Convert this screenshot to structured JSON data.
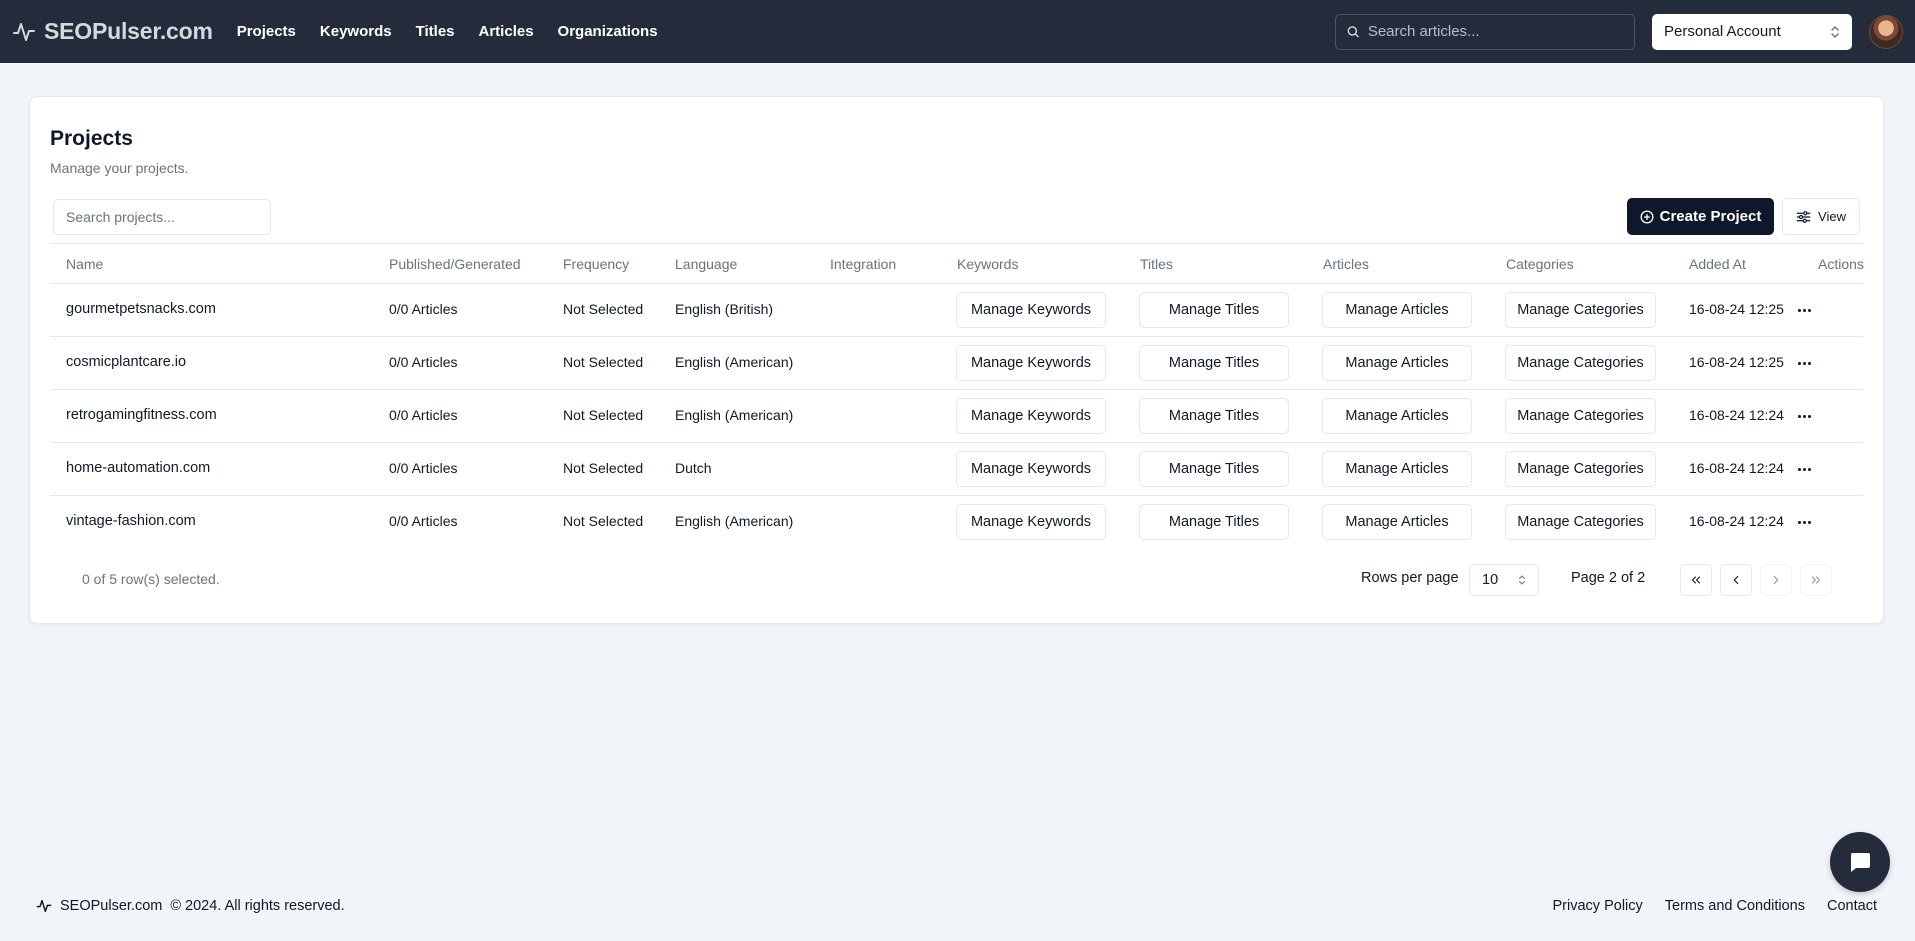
{
  "header": {
    "brand": "SEOPulser.com",
    "nav": [
      "Projects",
      "Keywords",
      "Titles",
      "Articles",
      "Organizations"
    ],
    "search_placeholder": "Search articles...",
    "account": "Personal Account"
  },
  "projects": {
    "title": "Projects",
    "subtitle": "Manage your projects.",
    "search_placeholder": "Search projects...",
    "create_label": "Create Project",
    "view_label": "View",
    "columns": [
      "Name",
      "Published/Generated",
      "Frequency",
      "Language",
      "Integration",
      "Keywords",
      "Titles",
      "Articles",
      "Categories",
      "Added At",
      "Actions"
    ],
    "button_labels": {
      "keywords": "Manage Keywords",
      "titles": "Manage Titles",
      "articles": "Manage Articles",
      "categories": "Manage Categories"
    },
    "rows": [
      {
        "name": "gourmetpetsnacks.com",
        "published": "0/0 Articles",
        "frequency": "Not Selected",
        "language": "English (British)",
        "integration": "",
        "added": "16-08-24 12:25"
      },
      {
        "name": "cosmicplantcare.io",
        "published": "0/0 Articles",
        "frequency": "Not Selected",
        "language": "English (American)",
        "integration": "",
        "added": "16-08-24 12:25"
      },
      {
        "name": "retrogamingfitness.com",
        "published": "0/0 Articles",
        "frequency": "Not Selected",
        "language": "English (American)",
        "integration": "",
        "added": "16-08-24 12:24"
      },
      {
        "name": "home-automation.com",
        "published": "0/0 Articles",
        "frequency": "Not Selected",
        "language": "Dutch",
        "integration": "",
        "added": "16-08-24 12:24"
      },
      {
        "name": "vintage-fashion.com",
        "published": "0/0 Articles",
        "frequency": "Not Selected",
        "language": "English (American)",
        "integration": "",
        "added": "16-08-24 12:24"
      }
    ],
    "selected_info": "0 of 5 row(s) selected.",
    "rows_per_page_label": "Rows per page",
    "rows_per_page": "10",
    "page_info": "Page 2 of 2"
  },
  "footer": {
    "brand": "SEOPulser.com",
    "copyright": "© 2024. All rights reserved.",
    "links": [
      "Privacy Policy",
      "Terms and Conditions",
      "Contact"
    ]
  },
  "colors": {
    "header_bg": "#242b3a",
    "page_bg": "#f1f4f8",
    "primary_button": "#0f172a",
    "border": "#e5e7eb",
    "muted_text": "#6b7280"
  }
}
